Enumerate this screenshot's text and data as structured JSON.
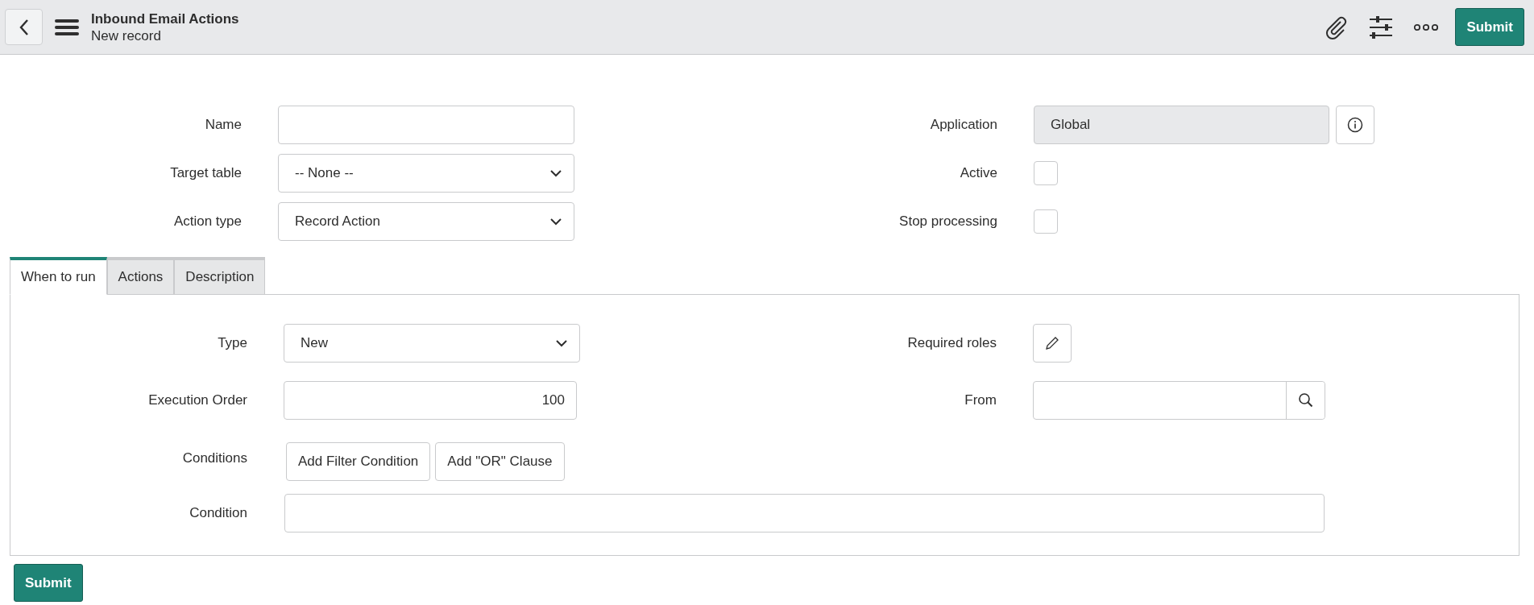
{
  "header": {
    "title": "Inbound Email Actions",
    "subtitle": "New record",
    "submit": "Submit"
  },
  "form_left": [
    {
      "kind": "text",
      "label": "Name"
    },
    {
      "kind": "select",
      "label": "Target table",
      "value": "-- None --"
    },
    {
      "kind": "select",
      "label": "Action type",
      "value": "Record Action"
    }
  ],
  "form_right": [
    {
      "kind": "readonly",
      "label": "Application",
      "value": "Global"
    },
    {
      "kind": "checkbox",
      "label": "Active",
      "checked": false
    },
    {
      "kind": "checkbox",
      "label": "Stop processing",
      "checked": false
    }
  ],
  "tabs": [
    {
      "label": "When to run",
      "selected": true
    },
    {
      "label": "Actions",
      "selected": false
    },
    {
      "label": "Description",
      "selected": false
    }
  ],
  "panel_left": [
    {
      "kind": "select",
      "label": "Type",
      "value": "New"
    },
    {
      "kind": "number",
      "label": "Execution Order",
      "value": "100"
    }
  ],
  "panel_right": [
    {
      "kind": "edit",
      "label": "Required roles"
    },
    {
      "kind": "reference",
      "label": "From"
    }
  ],
  "conditions": {
    "label": "Conditions",
    "buttons": [
      "Add Filter Condition",
      "Add \"OR\" Clause"
    ]
  },
  "condition": {
    "label": "Condition"
  },
  "footer": {
    "submit": "Submit"
  }
}
